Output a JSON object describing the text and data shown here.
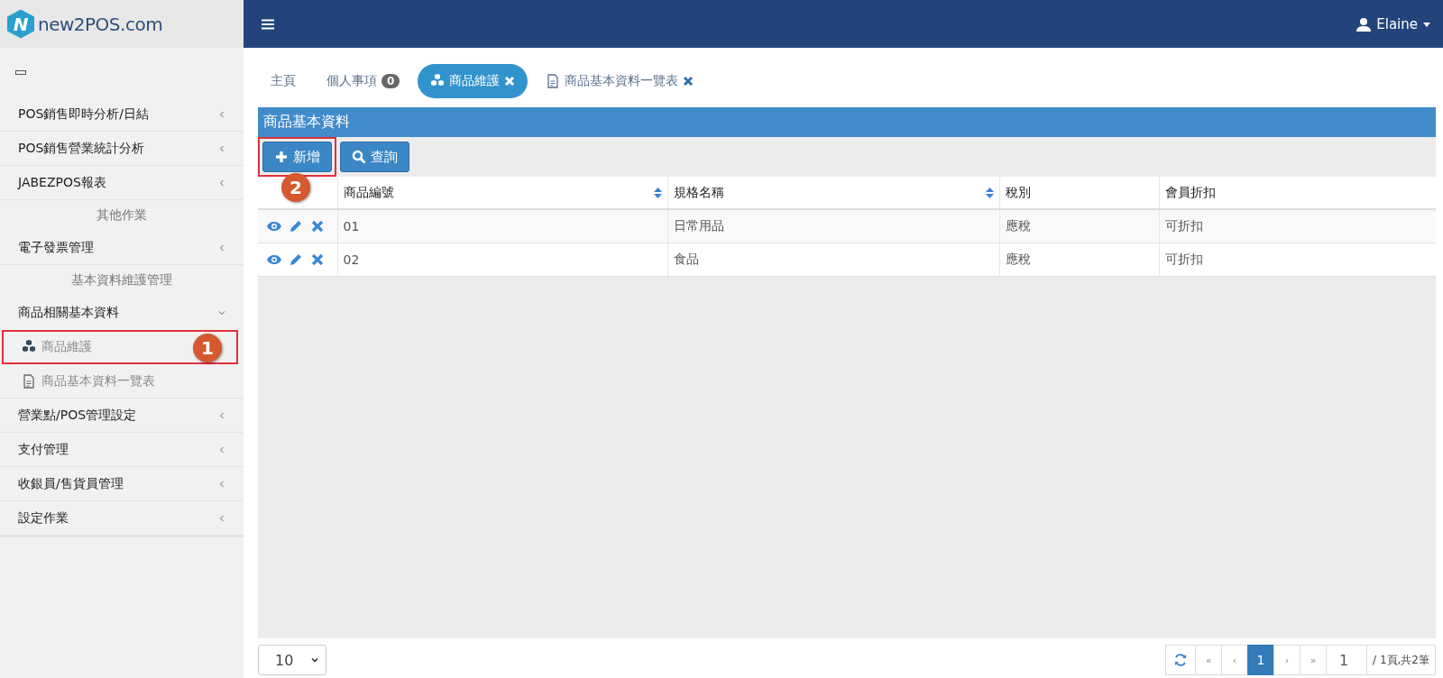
{
  "logo": {
    "mark": "N",
    "text": "new2POS.com"
  },
  "top_bar": {
    "user": "Elaine"
  },
  "sidebar": {
    "items": [
      {
        "kind": "group",
        "label": "POS銷售即時分析/日結",
        "expanded": false
      },
      {
        "kind": "group",
        "label": "POS銷售營業統計分析",
        "expanded": false
      },
      {
        "kind": "group",
        "label": "JABEZPOS報表",
        "expanded": false
      },
      {
        "kind": "label",
        "label": "其他作業"
      },
      {
        "kind": "group",
        "label": "電子發票管理",
        "expanded": false
      },
      {
        "kind": "label",
        "label": "基本資料維護管理"
      },
      {
        "kind": "group",
        "label": "商品相關基本資料",
        "expanded": true,
        "children": [
          {
            "kind": "product",
            "label": "商品維護",
            "selected": true,
            "callout": "1"
          },
          {
            "kind": "document",
            "label": "商品基本資料一覽表",
            "selected": false
          }
        ]
      },
      {
        "kind": "group",
        "label": "營業點/POS管理設定",
        "expanded": false
      },
      {
        "kind": "group",
        "label": "支付管理",
        "expanded": false
      },
      {
        "kind": "group",
        "label": "收銀員/售貨員管理",
        "expanded": false
      },
      {
        "kind": "group",
        "label": "設定作業",
        "expanded": false
      }
    ]
  },
  "tabs": [
    {
      "label": "主頁",
      "selected": false
    },
    {
      "label": "個人事項",
      "badge": "0",
      "selected": false
    },
    {
      "kind": "product",
      "label": "商品維護",
      "closable": true,
      "selected": true
    },
    {
      "kind": "document",
      "label": "商品基本資料一覽表",
      "closable": true,
      "selected": false
    }
  ],
  "panel": {
    "title": "商品基本資料",
    "buttons": [
      {
        "kind": "add",
        "label": "新增",
        "callout": "2"
      },
      {
        "kind": "search",
        "label": "查詢"
      }
    ],
    "table": {
      "columns": [
        {
          "label": "商品編號",
          "sortable": true
        },
        {
          "label": "規格名稱",
          "sortable": true
        },
        {
          "label": "稅別",
          "sortable": false
        },
        {
          "label": "會員折扣",
          "sortable": false
        }
      ],
      "rows": [
        [
          "01",
          "日常用品",
          "應稅",
          "可折扣"
        ],
        [
          "02",
          "食品",
          "應稅",
          "可折扣"
        ]
      ]
    }
  },
  "pager": {
    "page_size": "10",
    "buttons": [
      {
        "label": "«",
        "selected": false
      },
      {
        "label": "‹",
        "selected": false
      },
      {
        "label": "1",
        "selected": true
      },
      {
        "label": "›",
        "selected": false
      },
      {
        "label": "»",
        "selected": false
      }
    ],
    "page_input": "1",
    "summary": "/ 1頁,共2筆"
  }
}
